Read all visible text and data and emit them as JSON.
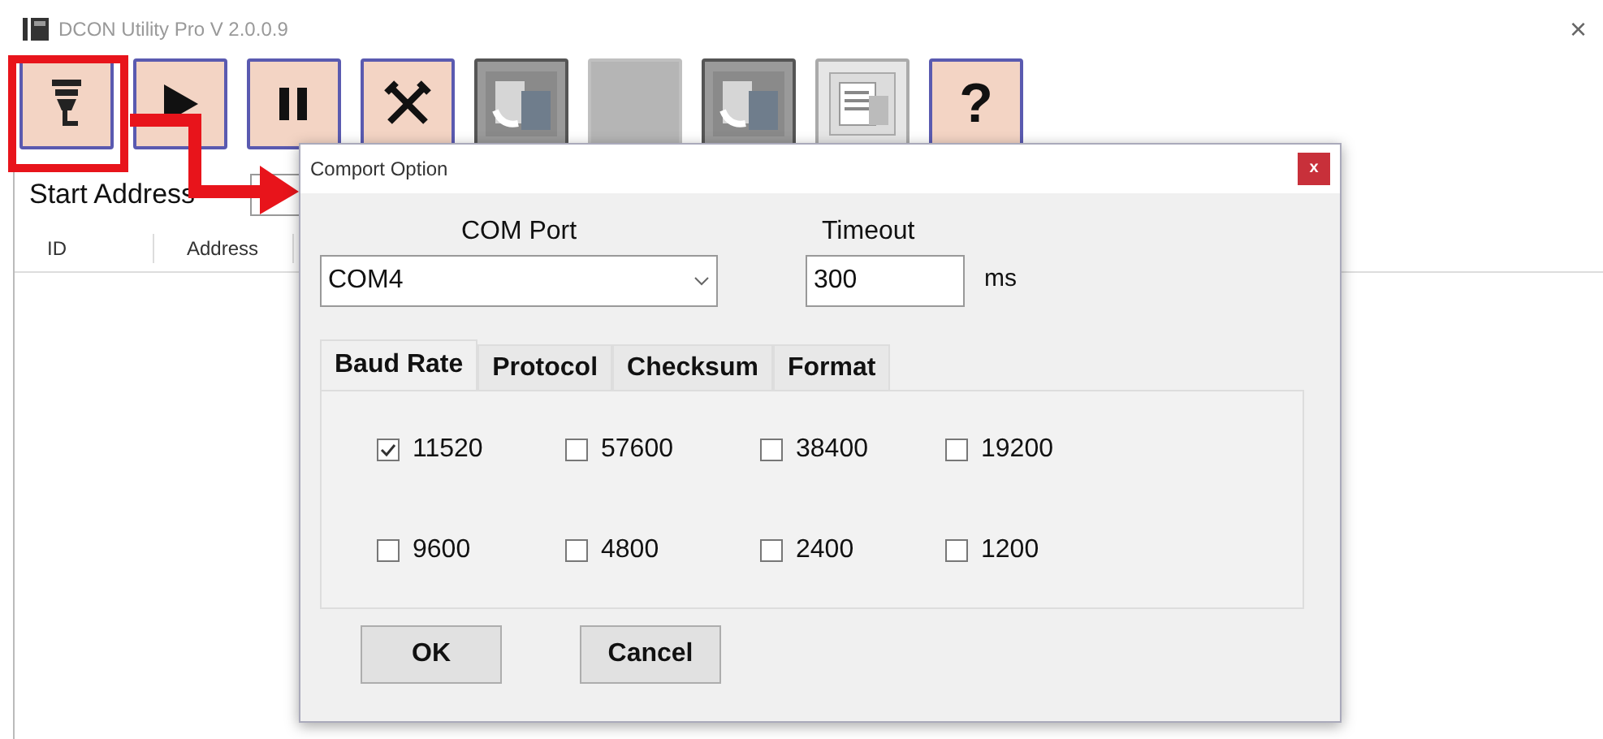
{
  "window": {
    "title": "DCON Utility Pro V 2.0.0.9",
    "close": "×"
  },
  "toolbar": [
    {
      "kind": "connector",
      "highlighted": true
    },
    {
      "kind": "play",
      "highlighted": false
    },
    {
      "kind": "pause",
      "highlighted": false
    },
    {
      "kind": "tools",
      "highlighted": false
    },
    {
      "kind": "device",
      "highlighted": false
    },
    {
      "kind": "blank",
      "highlighted": false
    },
    {
      "kind": "device",
      "highlighted": false
    },
    {
      "kind": "document",
      "highlighted": false
    },
    {
      "kind": "help",
      "label": "?",
      "highlighted": false
    }
  ],
  "start_address": {
    "label": "Start Address"
  },
  "table": {
    "columns": [
      "ID",
      "Address"
    ]
  },
  "dialog": {
    "title": "Comport Option",
    "close": "x",
    "com_port": {
      "label": "COM Port",
      "value": "COM4"
    },
    "timeout": {
      "label": "Timeout",
      "value": "300",
      "unit": "ms"
    },
    "tabs": [
      {
        "label": "Baud Rate",
        "selected": true
      },
      {
        "label": "Protocol",
        "selected": false
      },
      {
        "label": "Checksum",
        "selected": false
      },
      {
        "label": "Format",
        "selected": false
      }
    ],
    "baud_rates": [
      {
        "label": "11520",
        "checked": true
      },
      {
        "label": "57600",
        "checked": false
      },
      {
        "label": "38400",
        "checked": false
      },
      {
        "label": "19200",
        "checked": false
      },
      {
        "label": "9600",
        "checked": false
      },
      {
        "label": "4800",
        "checked": false
      },
      {
        "label": "2400",
        "checked": false
      },
      {
        "label": "1200",
        "checked": false
      }
    ],
    "buttons": [
      "OK",
      "Cancel"
    ]
  }
}
